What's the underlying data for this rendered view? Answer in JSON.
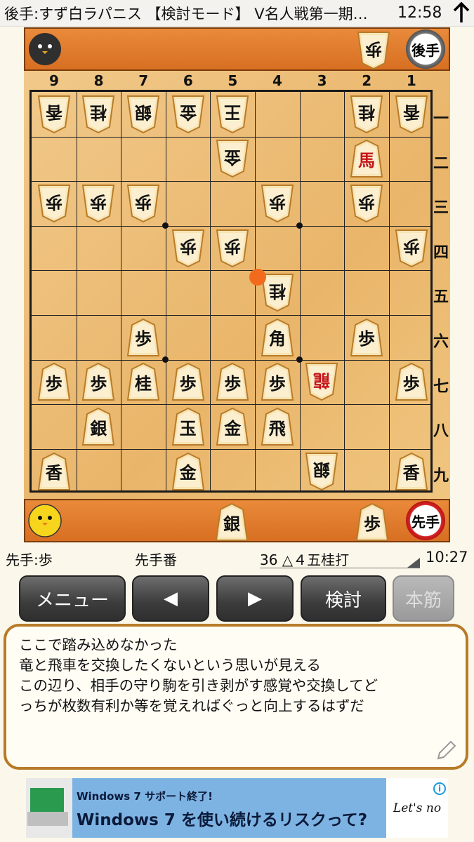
{
  "titlebar": {
    "title": "後手:すず白ラパニス 【検討モード】 V名人戦第一期…",
    "clock": "12:58"
  },
  "gote_hand": {
    "badge": "後手",
    "pieces": [
      "歩"
    ]
  },
  "sente_hand": {
    "badge": "先手",
    "pieces": [
      "銀",
      "歩"
    ]
  },
  "board": {
    "files": [
      "9",
      "8",
      "7",
      "6",
      "5",
      "4",
      "3",
      "2",
      "1"
    ],
    "ranks": [
      "一",
      "二",
      "三",
      "四",
      "五",
      "六",
      "七",
      "八",
      "九"
    ],
    "pieces": [
      {
        "file": 9,
        "rank": 1,
        "label": "香",
        "owner": "gote"
      },
      {
        "file": 8,
        "rank": 1,
        "label": "桂",
        "owner": "gote"
      },
      {
        "file": 7,
        "rank": 1,
        "label": "銀",
        "owner": "gote"
      },
      {
        "file": 6,
        "rank": 1,
        "label": "金",
        "owner": "gote"
      },
      {
        "file": 5,
        "rank": 1,
        "label": "王",
        "owner": "gote"
      },
      {
        "file": 2,
        "rank": 1,
        "label": "桂",
        "owner": "gote"
      },
      {
        "file": 1,
        "rank": 1,
        "label": "香",
        "owner": "gote"
      },
      {
        "file": 5,
        "rank": 2,
        "label": "金",
        "owner": "gote"
      },
      {
        "file": 2,
        "rank": 2,
        "label": "馬",
        "owner": "sente",
        "promoted": true
      },
      {
        "file": 9,
        "rank": 3,
        "label": "歩",
        "owner": "gote"
      },
      {
        "file": 8,
        "rank": 3,
        "label": "歩",
        "owner": "gote"
      },
      {
        "file": 7,
        "rank": 3,
        "label": "歩",
        "owner": "gote"
      },
      {
        "file": 4,
        "rank": 3,
        "label": "歩",
        "owner": "gote"
      },
      {
        "file": 2,
        "rank": 3,
        "label": "歩",
        "owner": "gote"
      },
      {
        "file": 6,
        "rank": 4,
        "label": "歩",
        "owner": "gote"
      },
      {
        "file": 5,
        "rank": 4,
        "label": "歩",
        "owner": "gote"
      },
      {
        "file": 1,
        "rank": 4,
        "label": "歩",
        "owner": "gote"
      },
      {
        "file": 4,
        "rank": 5,
        "label": "桂",
        "owner": "gote"
      },
      {
        "file": 7,
        "rank": 6,
        "label": "歩",
        "owner": "sente"
      },
      {
        "file": 4,
        "rank": 6,
        "label": "角",
        "owner": "sente"
      },
      {
        "file": 2,
        "rank": 6,
        "label": "歩",
        "owner": "sente"
      },
      {
        "file": 9,
        "rank": 7,
        "label": "歩",
        "owner": "sente"
      },
      {
        "file": 8,
        "rank": 7,
        "label": "歩",
        "owner": "sente"
      },
      {
        "file": 7,
        "rank": 7,
        "label": "桂",
        "owner": "sente"
      },
      {
        "file": 6,
        "rank": 7,
        "label": "歩",
        "owner": "sente"
      },
      {
        "file": 5,
        "rank": 7,
        "label": "歩",
        "owner": "sente"
      },
      {
        "file": 4,
        "rank": 7,
        "label": "歩",
        "owner": "sente"
      },
      {
        "file": 3,
        "rank": 7,
        "label": "龍",
        "owner": "gote",
        "promoted": true
      },
      {
        "file": 1,
        "rank": 7,
        "label": "歩",
        "owner": "sente"
      },
      {
        "file": 8,
        "rank": 8,
        "label": "銀",
        "owner": "sente"
      },
      {
        "file": 6,
        "rank": 8,
        "label": "玉",
        "owner": "sente"
      },
      {
        "file": 5,
        "rank": 8,
        "label": "金",
        "owner": "sente"
      },
      {
        "file": 4,
        "rank": 8,
        "label": "飛",
        "owner": "sente"
      },
      {
        "file": 9,
        "rank": 9,
        "label": "香",
        "owner": "sente"
      },
      {
        "file": 6,
        "rank": 9,
        "label": "金",
        "owner": "sente"
      },
      {
        "file": 3,
        "rank": 9,
        "label": "銀",
        "owner": "gote"
      },
      {
        "file": 1,
        "rank": 9,
        "label": "香",
        "owner": "sente"
      }
    ],
    "last_move": {
      "file": 4,
      "rank": 5
    }
  },
  "info": {
    "sente_hand_text": "先手:歩",
    "turn_text": "先手番",
    "move_text": "36 △４五桂打",
    "time": "10:27"
  },
  "buttons": {
    "menu": "メニュー",
    "prev": "◀",
    "next": "▶",
    "analyze": "検討",
    "mainline": "本筋"
  },
  "comment": {
    "lines": [
      "ここで踏み込めなかった",
      "竜と飛車を交換したくないという思いが見える",
      "この辺り、相手の守り駒を引き剥がす感覚や交換してど",
      "っちが枚数有利か等を覚えればぐっと向上するはずだ"
    ]
  },
  "ad": {
    "line1": "Windows 7 サポート終了!",
    "line2": "Windows 7 を使い続けるリスクって?",
    "logo": "Let's no"
  }
}
